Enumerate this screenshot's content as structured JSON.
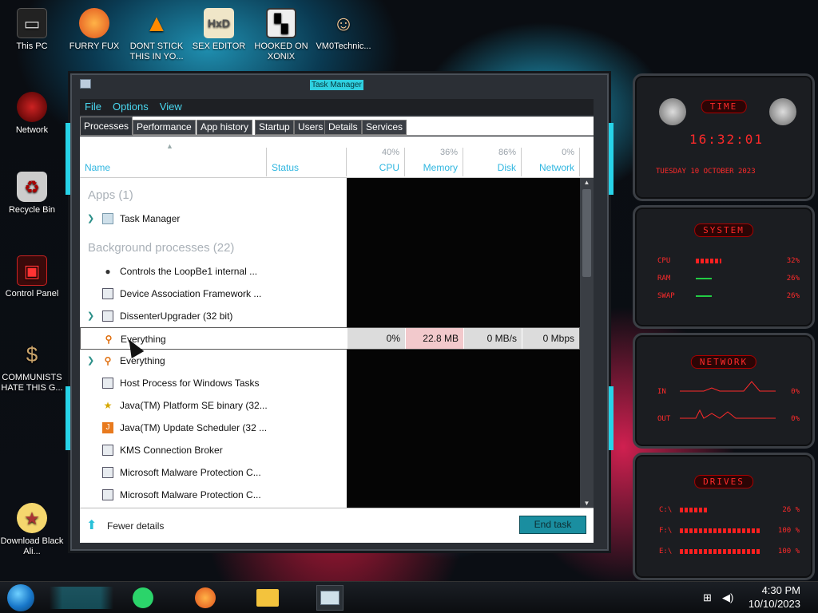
{
  "desktop": {
    "icons": [
      {
        "label": "This PC",
        "icon": "computer-icon"
      },
      {
        "label": "FURRY FUX",
        "icon": "firefox-icon"
      },
      {
        "label": "DONT STICK THIS IN YO...",
        "icon": "vlc-icon"
      },
      {
        "label": "SEX EDITOR",
        "icon": "hxd-icon"
      },
      {
        "label": "HOOKED ON XONIX",
        "icon": "game-icon"
      },
      {
        "label": "VM0Technic...",
        "icon": "doctor-icon"
      },
      {
        "label": "Network",
        "icon": "network-icon"
      },
      {
        "label": "Recycle Bin",
        "icon": "recycle-bin-icon"
      },
      {
        "label": "Control Panel",
        "icon": "control-panel-icon"
      },
      {
        "label": "COMMUNISTS HATE THIS G...",
        "icon": "money-bag-icon"
      },
      {
        "label": "Download Black Ali...",
        "icon": "download-icon"
      }
    ]
  },
  "window": {
    "title": "Task Manager",
    "menu": [
      "File",
      "Options",
      "View"
    ],
    "tabs": [
      "Processes",
      "Performance",
      "App history",
      "Startup",
      "Users",
      "Details",
      "Services"
    ],
    "active_tab": "Processes",
    "columns": {
      "name": "Name",
      "status": "Status",
      "cpu": {
        "label": "CPU",
        "pct": "40%"
      },
      "memory": {
        "label": "Memory",
        "pct": "36%"
      },
      "disk": {
        "label": "Disk",
        "pct": "86%"
      },
      "network": {
        "label": "Network",
        "pct": "0%"
      }
    },
    "sections": {
      "apps": "Apps (1)",
      "background": "Background processes (22)"
    },
    "apps": [
      {
        "name": "Task Manager",
        "expandable": true,
        "icon": "task-manager-icon"
      }
    ],
    "background": [
      {
        "name": "Controls the LoopBe1 internal ...",
        "expandable": false,
        "icon": "mouse-icon"
      },
      {
        "name": "Device Association Framework ...",
        "expandable": false,
        "icon": "window-app-icon"
      },
      {
        "name": "DissenterUpgrader (32 bit)",
        "expandable": true,
        "icon": "window-app-icon"
      },
      {
        "name": "Everything",
        "expandable": false,
        "icon": "magnifier-icon",
        "selected": true,
        "cpu": "0%",
        "memory": "22.8 MB",
        "disk": "0 MB/s",
        "network": "0 Mbps"
      },
      {
        "name": "Everything",
        "expandable": true,
        "icon": "magnifier-icon"
      },
      {
        "name": "Host Process for Windows Tasks",
        "expandable": false,
        "icon": "window-app-icon"
      },
      {
        "name": "Java(TM) Platform SE binary (32...",
        "expandable": false,
        "icon": "java-icon"
      },
      {
        "name": "Java(TM) Update Scheduler (32 ...",
        "expandable": false,
        "icon": "java-update-icon"
      },
      {
        "name": "KMS Connection Broker",
        "expandable": false,
        "icon": "window-app-icon"
      },
      {
        "name": "Microsoft Malware Protection C...",
        "expandable": false,
        "icon": "window-app-icon"
      },
      {
        "name": "Microsoft Malware Protection C...",
        "expandable": false,
        "icon": "window-app-icon"
      }
    ],
    "footer": {
      "fewer_details": "Fewer details",
      "end_task": "End task"
    }
  },
  "gadgets": {
    "time": {
      "title": "TIME",
      "clock": "16:32:01",
      "date": "TUESDAY 10 OCTOBER 2023"
    },
    "system": {
      "title": "SYSTEM",
      "rows": [
        {
          "label": "CPU",
          "value": "32%",
          "level": 0.32
        },
        {
          "label": "RAM",
          "value": "26%",
          "level": 0.26
        },
        {
          "label": "SWAP",
          "value": "26%",
          "level": 0.26
        }
      ]
    },
    "network": {
      "title": "NETWORK",
      "rows": [
        {
          "label": "IN",
          "value": "0%"
        },
        {
          "label": "OUT",
          "value": "0%"
        }
      ]
    },
    "drives": {
      "title": "DRIVES",
      "rows": [
        {
          "label": "C:\\",
          "value": "26 %",
          "level": 0.26
        },
        {
          "label": "F:\\",
          "value": "100 %",
          "level": 1.0
        },
        {
          "label": "E:\\",
          "value": "100 %",
          "level": 1.0
        }
      ]
    }
  },
  "taskbar": {
    "apps": [
      "notes-icon",
      "firefox-icon",
      "file-explorer-icon",
      "task-manager-icon"
    ],
    "time": "4:30 PM",
    "date": "10/10/2023"
  },
  "colors": {
    "accent": "#27d3e8",
    "gadget_red": "#ff2a2a",
    "memory_highlight": "#f2c9cc"
  }
}
